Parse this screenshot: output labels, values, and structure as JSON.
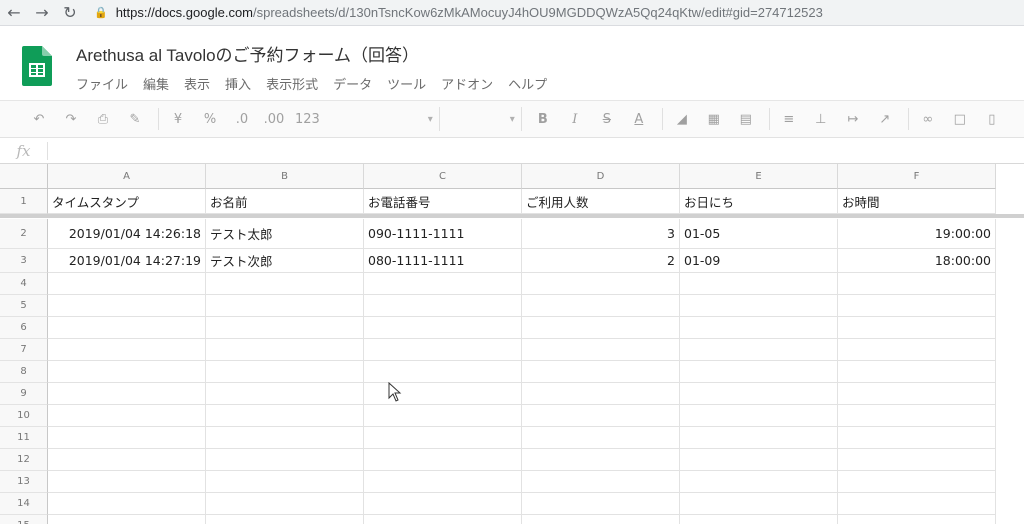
{
  "browser": {
    "url_host": "https://docs.google.com",
    "url_path": "/spreadsheets/d/130nTsncKow6zMkAMocuyJ4hOU9MGDDQWzA5Qq24qKtw/edit#gid=274712523"
  },
  "doc": {
    "title": "Arethusa al Tavoloのご予約フォーム（回答）"
  },
  "menu": [
    "ファイル",
    "編集",
    "表示",
    "挿入",
    "表示形式",
    "データ",
    "ツール",
    "アドオン",
    "ヘルプ"
  ],
  "toolbar": {
    "currency": "¥",
    "percent": "%",
    "decrease_decimal": ".0",
    "increase_decimal": ".00",
    "format_more": "123"
  },
  "formula_bar": {
    "fx_label": "fx",
    "value": ""
  },
  "columns": [
    "A",
    "B",
    "C",
    "D",
    "E",
    "F"
  ],
  "rows": [
    "1",
    "2",
    "3",
    "4",
    "5",
    "6",
    "7",
    "8",
    "9",
    "10",
    "11",
    "12",
    "13",
    "14",
    "15"
  ],
  "header_row": [
    "タイムスタンプ",
    "お名前",
    "お電話番号",
    "ご利用人数",
    "お日にち",
    "お時間"
  ],
  "data_rows": [
    [
      "2019/01/04 14:26:18",
      "テスト太郎",
      "090-1111-1111",
      "3",
      "01-05",
      "19:00:00"
    ],
    [
      "2019/01/04 14:27:19",
      "テスト次郎",
      "080-1111-1111",
      "2",
      "01-09",
      "18:00:00"
    ]
  ],
  "colors": {
    "sheets_green": "#0f9d58",
    "sheets_green_dark": "#0b8043"
  }
}
